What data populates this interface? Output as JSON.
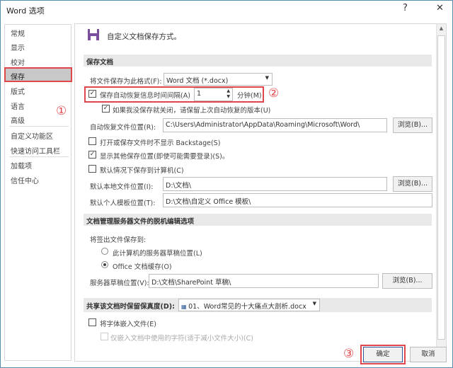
{
  "window": {
    "title": "Word 选项",
    "help": "?",
    "close": "✕"
  },
  "sidebar": {
    "items": [
      {
        "label": "常规"
      },
      {
        "label": "显示"
      },
      {
        "label": "校对"
      },
      {
        "label": "保存"
      },
      {
        "label": "版式"
      },
      {
        "label": "语言"
      },
      {
        "label": "高级"
      },
      {
        "label": "自定义功能区"
      },
      {
        "label": "快速访问工具栏"
      },
      {
        "label": "加载项"
      },
      {
        "label": "信任中心"
      }
    ],
    "selected": "保存"
  },
  "header": {
    "icon": "floppy-disk-icon",
    "text": "自定义文档保存方式。",
    "icon_color": "#7b4f9e"
  },
  "save_docs": {
    "title": "保存文档",
    "format_label": "将文件保存为此格式(F):",
    "format_value": "Word 文档 (*.docx)",
    "autorecover_label": "保存自动恢复信息时间间隔(A)",
    "autorecover_checked": true,
    "autorecover_minutes": "1",
    "minutes_label": "分钟(M)",
    "keep_last_label": "如果我没保存就关闭，请保留上次自动恢复的版本(U)",
    "keep_last_checked": true,
    "autorecover_path_label": "自动恢复文件位置(R):",
    "autorecover_path": "C:\\Users\\Administrator\\AppData\\Roaming\\Microsoft\\Word\\",
    "browse": "浏览(B)...",
    "no_backstage_label": "打开或保存文件时不显示 Backstage(S)",
    "no_backstage_checked": false,
    "show_other_label": "显示其他保存位置(即使可能需要登录)(S)。",
    "show_other_checked": true,
    "save_computer_label": "默认情况下保存到计算机(C)",
    "save_computer_checked": false,
    "local_path_label": "默认本地文件位置(I):",
    "local_path": "D:\\文档\\",
    "template_path_label": "默认个人模板位置(T):",
    "template_path": "D:\\文档\\自定义 Office 模板\\"
  },
  "offline": {
    "title": "文档管理服务器文件的脱机编辑选项",
    "checkout_label": "将签出文件保存到:",
    "radio1": "此计算机的服务器草稿位置(L)",
    "radio2": "Office 文档缓存(O)",
    "selected": "Office 文档缓存(O)",
    "drafts_label": "服务器草稿位置(V):",
    "drafts_path": "D:\\文档\\SharePoint 草稿\\"
  },
  "fidelity": {
    "title": "共享该文档时保留保真度(D):",
    "document": "01、Word常见的十大痛点大剖析.docx",
    "embed_label": "将字体嵌入文件(E)",
    "embed_checked": false,
    "embed_used_label": "仅嵌入文档中使用的字符(适于减小文件大小)(C)"
  },
  "footer": {
    "ok": "确定",
    "cancel": "取消"
  },
  "annotations": {
    "step1": "①",
    "step2": "②",
    "step3": "③",
    "color": "#e0474c"
  }
}
